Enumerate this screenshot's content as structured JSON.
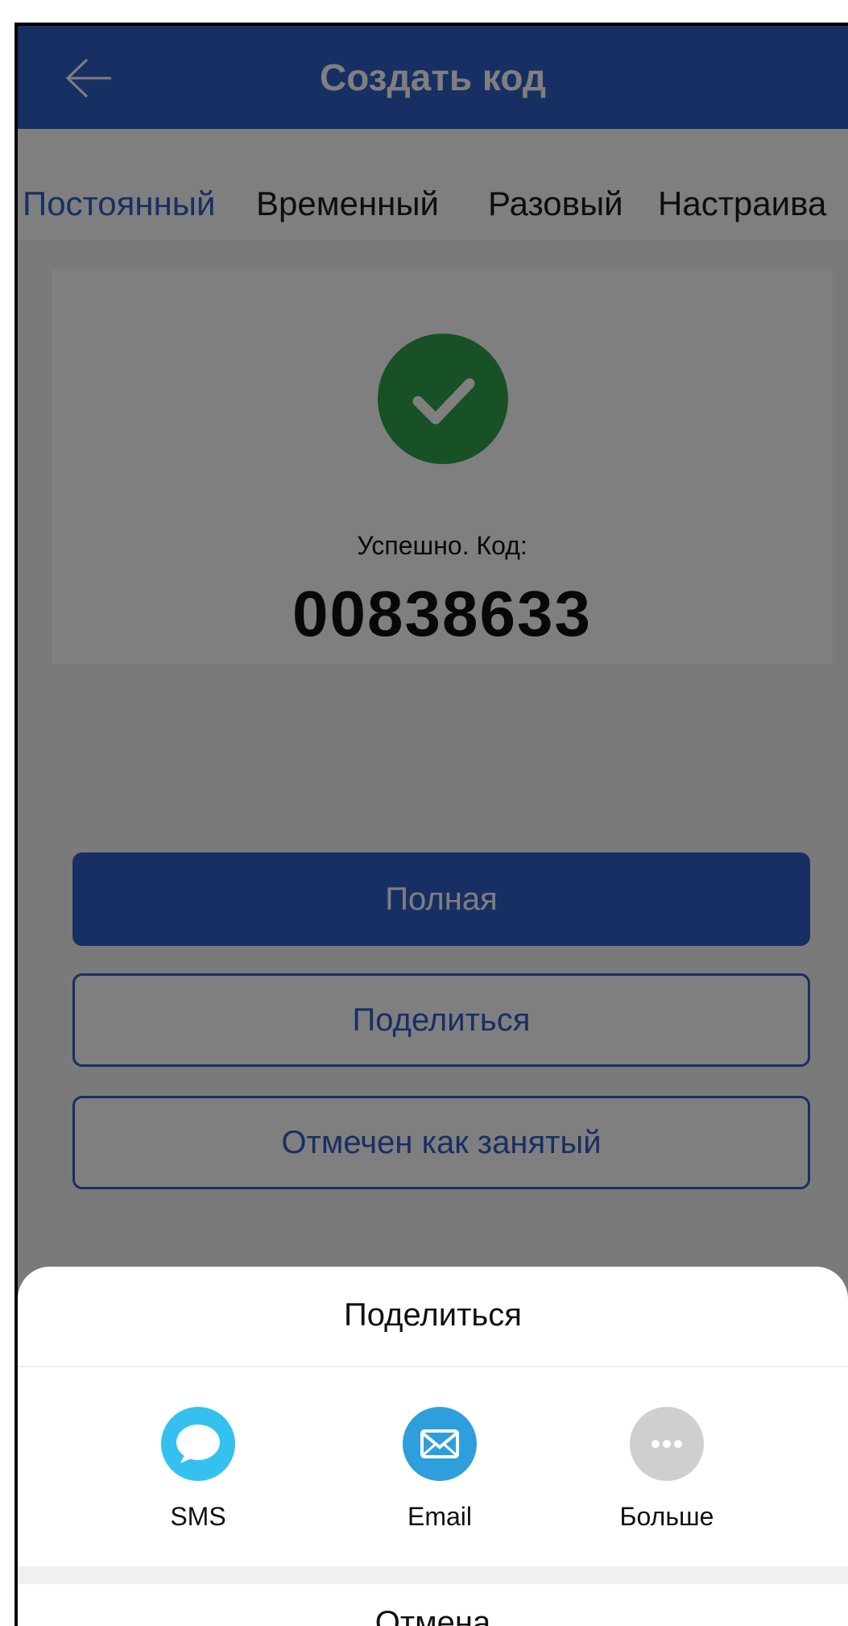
{
  "header": {
    "title": "Создать код",
    "bar_color": "#2f5ec6"
  },
  "tabs": [
    {
      "label": "Постоянный",
      "active": true
    },
    {
      "label": "Временный",
      "active": false
    },
    {
      "label": "Разовый",
      "active": false
    },
    {
      "label": "Настраива",
      "active": false
    }
  ],
  "result": {
    "success_label": "Успешно. Код:",
    "code": "00838633",
    "icon": "check-circle-icon",
    "icon_color": "#2fa34a"
  },
  "buttons": {
    "full_label": "Полная",
    "share_label": "Поделиться",
    "busy_label": "Отмечен как занятый"
  },
  "share_sheet": {
    "title": "Поделиться",
    "options": [
      {
        "label": "SMS",
        "icon": "sms-bubble-icon",
        "color": "#35c1ef"
      },
      {
        "label": "Email",
        "icon": "envelope-icon",
        "color": "#2e9fdc"
      },
      {
        "label": "Больше",
        "icon": "more-dots-icon",
        "color": "#cfcfcf"
      }
    ],
    "cancel_label": "Отмена"
  }
}
